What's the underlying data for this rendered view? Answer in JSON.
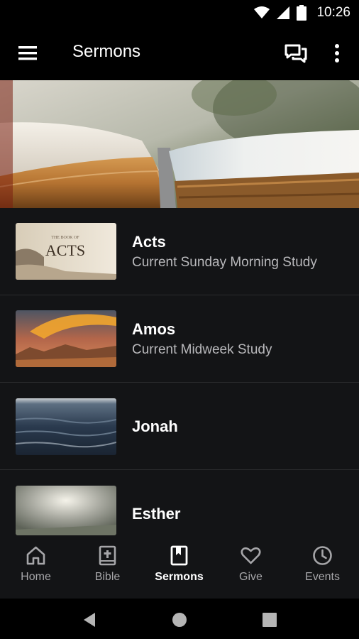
{
  "status_bar": {
    "time": "10:26",
    "icons": [
      "wifi-icon",
      "signal-icon",
      "battery-icon"
    ]
  },
  "app_bar": {
    "title": "Sermons",
    "icons": [
      "menu-icon",
      "chat-icon",
      "more-vert-icon"
    ]
  },
  "sermons": [
    {
      "title": "Acts",
      "subtitle": "Current Sunday Morning Study",
      "thumb_text_small": "THE BOOK OF",
      "thumb_text": "ACTS"
    },
    {
      "title": "Amos",
      "subtitle": "Current Midweek Study"
    },
    {
      "title": "Jonah",
      "subtitle": ""
    },
    {
      "title": "Esther",
      "subtitle": ""
    }
  ],
  "bottom_nav": [
    {
      "label": "Home",
      "icon": "home-icon"
    },
    {
      "label": "Bible",
      "icon": "bible-icon"
    },
    {
      "label": "Sermons",
      "icon": "bookmark-book-icon",
      "active": true
    },
    {
      "label": "Give",
      "icon": "heart-icon"
    },
    {
      "label": "Events",
      "icon": "clock-icon"
    }
  ],
  "colors": {
    "background": "#000000",
    "list_bg": "#131416",
    "divider": "#2a2b2e",
    "subtitle": "#b9b9bc",
    "nav_inactive": "#a6a6a9"
  }
}
